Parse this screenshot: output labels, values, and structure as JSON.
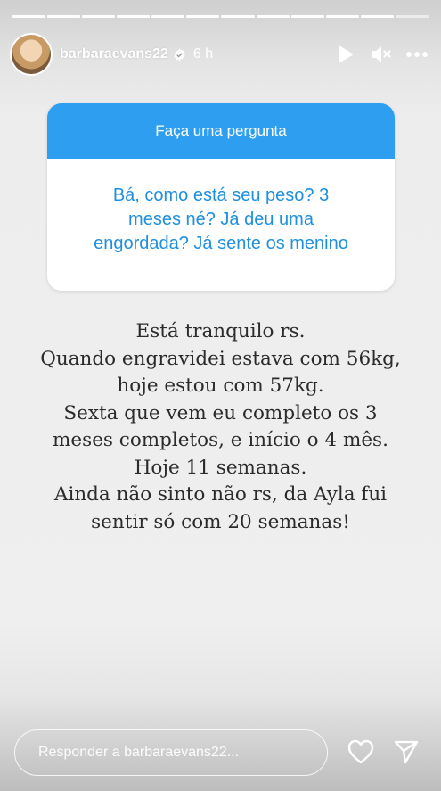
{
  "story": {
    "segments": 12,
    "active_segment": 10
  },
  "header": {
    "username": "barbaraevans22",
    "time": "6 h",
    "avatar_icon": "profile-avatar",
    "verified_icon": "verified-badge-icon",
    "play_icon": "play-icon",
    "mute_icon": "muted-speaker-icon",
    "more_icon": "more-dots-icon"
  },
  "question": {
    "title": "Faça uma pergunta",
    "lines": [
      "Bá, como está seu peso? 3",
      "meses né? Já deu uma",
      "engordada? Já sente os menino"
    ],
    "header_color": "#2d9ef0",
    "text_color": "#1f8fe0"
  },
  "answer": {
    "lines": [
      "Está tranquilo rs.",
      "Quando engravidei estava com 56kg,",
      "hoje estou com 57kg.",
      "Sexta que vem eu completo os 3",
      "meses completos, e início o 4 mês.",
      "Hoje 11 semanas.",
      "Ainda não sinto não rs, da Ayla fui",
      "sentir só com 20 semanas!"
    ]
  },
  "footer": {
    "reply_placeholder": "Responder a barbaraevans22...",
    "like_icon": "heart-icon",
    "share_icon": "send-icon"
  }
}
